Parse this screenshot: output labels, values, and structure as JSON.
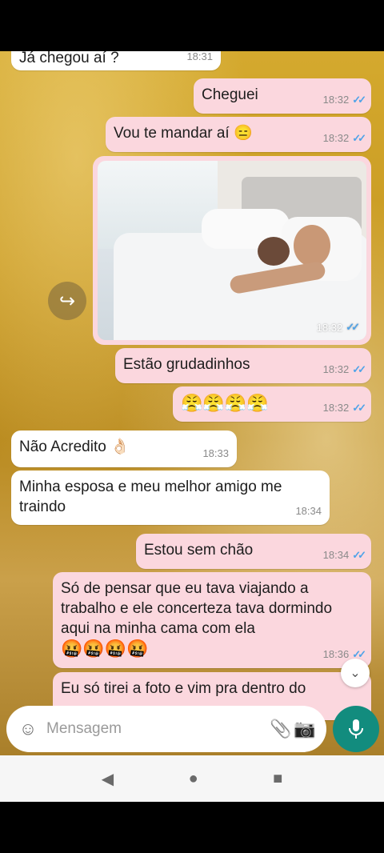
{
  "messages": [
    {
      "text": "Já chegou aí ?",
      "time": "18:31"
    },
    {
      "text": "Cheguei",
      "time": "18:32"
    },
    {
      "text": "Vou te mandar aí 😑",
      "time": "18:32"
    },
    {
      "text": "",
      "time": "18:32"
    },
    {
      "text": "Estão grudadinhos",
      "time": "18:32"
    },
    {
      "text": "😤😤😤😤",
      "time": "18:32"
    },
    {
      "text": "Não Acredito 👌🏻",
      "time": "18:33"
    },
    {
      "text": "Minha esposa e meu melhor amigo me traindo",
      "time": "18:34"
    },
    {
      "text": "Estou sem chão",
      "time": "18:34"
    },
    {
      "text": "Só de pensar que eu tava  viajando a trabalho e ele concerteza tava dormindo aqui na minha cama com ela",
      "emoji": "🤬🤬🤬🤬",
      "time": "18:36"
    },
    {
      "text": "Eu só tirei a foto e vim pra dentro do",
      "time": ""
    }
  ],
  "ticks": "✓✓",
  "input": {
    "placeholder": "Mensagem"
  },
  "icons": {
    "forward": "↪",
    "scroll": "⌄",
    "emoji": "☺",
    "attach": "📎",
    "camera": "📷",
    "mic": "mic-icon",
    "back": "◀",
    "home": "●",
    "recents": "■"
  },
  "colors": {
    "outgoing": "#fbd7de",
    "incoming": "#ffffff",
    "read_ticks": "#4fa3e8",
    "mic_button": "#128c7e"
  }
}
